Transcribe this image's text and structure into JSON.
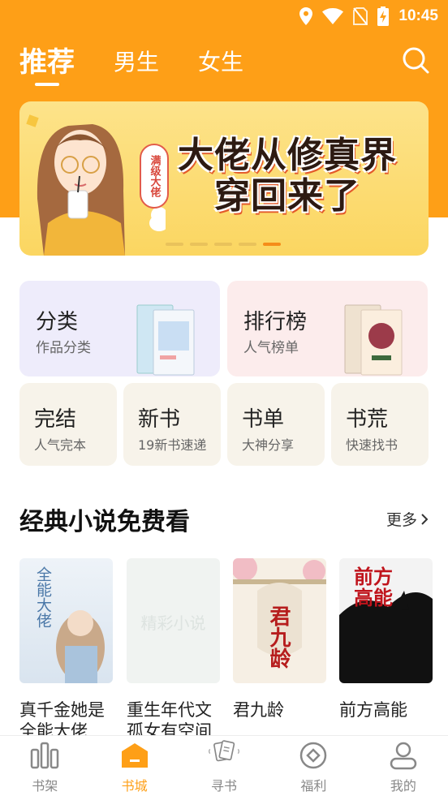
{
  "status_bar": {
    "time": "10:45"
  },
  "top_tabs": [
    {
      "label": "推荐",
      "active": true
    },
    {
      "label": "男生",
      "active": false
    },
    {
      "label": "女生",
      "active": false
    }
  ],
  "banner": {
    "title_line1": "大佬从修真界",
    "title_line2": "穿回来了",
    "tag": "满级大佬",
    "dots": 5,
    "active_dot": 4
  },
  "categories": [
    {
      "title": "分类",
      "subtitle": "作品分类",
      "bg": "#eeecfb"
    },
    {
      "title": "排行榜",
      "subtitle": "人气榜单",
      "bg": "#fcecec"
    }
  ],
  "quick_links": [
    {
      "title": "完结",
      "subtitle": "人气完本"
    },
    {
      "title": "新书",
      "subtitle": "19新书速递"
    },
    {
      "title": "书单",
      "subtitle": "大神分享"
    },
    {
      "title": "书荒",
      "subtitle": "快速找书"
    }
  ],
  "section": {
    "title": "经典小说免费看",
    "more": "更多"
  },
  "books": [
    {
      "name": "真千金她是全能大佬",
      "cover_text": "全能大佬"
    },
    {
      "name": "重生年代文孤女有空间",
      "cover_text": "精彩小说"
    },
    {
      "name": "君九龄",
      "cover_text": "君九龄"
    },
    {
      "name": "前方高能",
      "cover_text": "前方高能"
    }
  ],
  "bottom_nav": [
    {
      "label": "书架",
      "icon": "bookshelf-icon",
      "active": false
    },
    {
      "label": "书城",
      "icon": "bookstore-icon",
      "active": true
    },
    {
      "label": "寻书",
      "icon": "find-book-icon",
      "active": false
    },
    {
      "label": "福利",
      "icon": "welfare-icon",
      "active": false
    },
    {
      "label": "我的",
      "icon": "profile-icon",
      "active": false
    }
  ],
  "colors": {
    "accent": "#fe9f17",
    "nav_inactive": "#888888"
  }
}
